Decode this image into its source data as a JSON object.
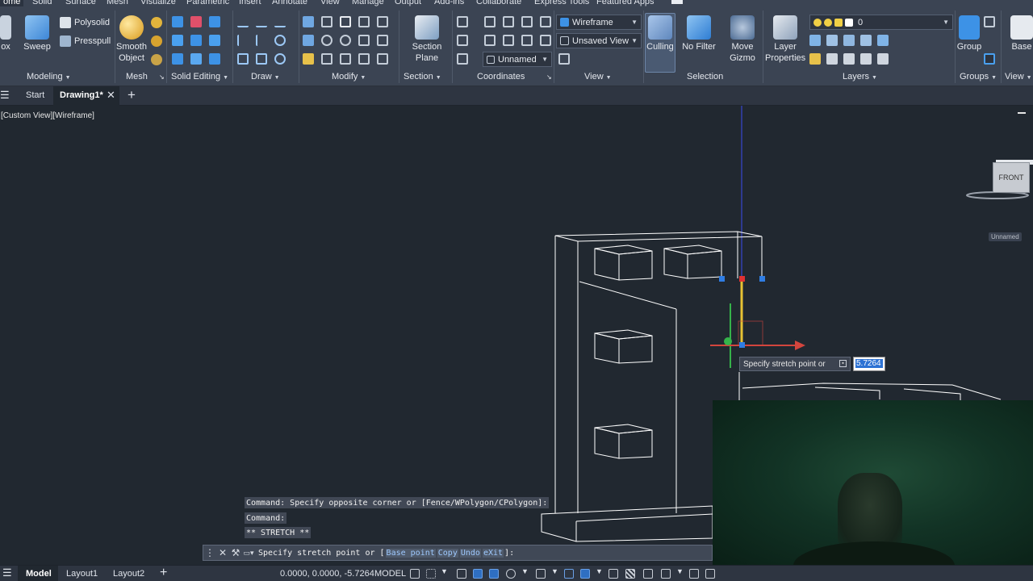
{
  "ribbon_tabs": [
    "ome",
    "Solid",
    "Surface",
    "Mesh",
    "Visualize",
    "Parametric",
    "Insert",
    "Annotate",
    "View",
    "Manage",
    "Output",
    "Add-ins",
    "Collaborate",
    "Express Tools",
    "Featured Apps"
  ],
  "panels": {
    "modeling": {
      "label": "Modeling",
      "box_label": "ox",
      "sweep_label": "Sweep",
      "polysolid_label": "Polysolid",
      "presspull_label": "Presspull"
    },
    "mesh": {
      "label": "Mesh",
      "smooth_object_label_1": "Smooth",
      "smooth_object_label_2": "Object"
    },
    "solid_editing": {
      "label": "Solid Editing"
    },
    "draw": {
      "label": "Draw"
    },
    "modify": {
      "label": "Modify"
    },
    "section": {
      "label": "Section",
      "section_plane_label_1": "Section",
      "section_plane_label_2": "Plane"
    },
    "coordinates": {
      "label": "Coordinates",
      "ucs_value": "Unnamed"
    },
    "view": {
      "label": "View",
      "visual_style": "Wireframe",
      "saved_view": "Unsaved View"
    },
    "selection": {
      "label": "Selection",
      "culling_label": "Culling",
      "no_filter_label": "No Filter",
      "move_gizmo_label_1": "Move",
      "move_gizmo_label_2": "Gizmo"
    },
    "layers": {
      "label": "Layers",
      "layer_properties_label_1": "Layer",
      "layer_properties_label_2": "Properties",
      "current_layer": "0"
    },
    "groups": {
      "label": "Groups",
      "group_label": "Group"
    },
    "view2": {
      "label": "View",
      "base_label": "Base"
    }
  },
  "doc_tabs": {
    "start": "Start",
    "drawing": "Drawing1*"
  },
  "viewport": {
    "label": "[Custom View][Wireframe]",
    "viewcube_face": "FRONT",
    "ucs_name": "Unnamed",
    "tooltip": "Specify stretch point or",
    "dynamic_input_value": "5.7264"
  },
  "command": {
    "history": [
      "Command: Specify opposite corner or [Fence/WPolygon/CPolygon]:",
      "Command:",
      "** STRETCH **"
    ],
    "prompt_prefix": "Specify stretch point or",
    "options": [
      "Base point",
      "Copy",
      "Undo",
      "eXit"
    ],
    "prompt_suffix": "]:"
  },
  "statusbar": {
    "tabs": [
      "Model",
      "Layout1",
      "Layout2"
    ],
    "add_symbol": "+",
    "coordinates": "0.0000, 0.0000, -5.7264",
    "space": "MODEL"
  }
}
